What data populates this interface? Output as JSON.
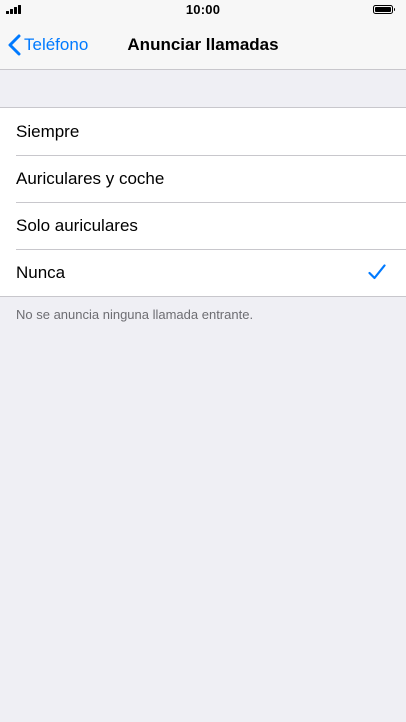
{
  "status_bar": {
    "time": "10:00",
    "signal_icon": "signal-bars-icon",
    "battery_icon": "battery-full-icon"
  },
  "nav": {
    "back_label": "Teléfono",
    "back_icon": "chevron-left-icon",
    "title": "Anunciar llamadas"
  },
  "options": [
    {
      "label": "Siempre",
      "selected": false
    },
    {
      "label": "Auriculares y coche",
      "selected": false
    },
    {
      "label": "Solo auriculares",
      "selected": false
    },
    {
      "label": "Nunca",
      "selected": true
    }
  ],
  "footer_note": "No se anuncia ninguna llamada entrante.",
  "colors": {
    "accent": "#007aff",
    "background": "#efeff4",
    "separator": "#c8c7cc",
    "footer_text": "#6d6d72"
  }
}
